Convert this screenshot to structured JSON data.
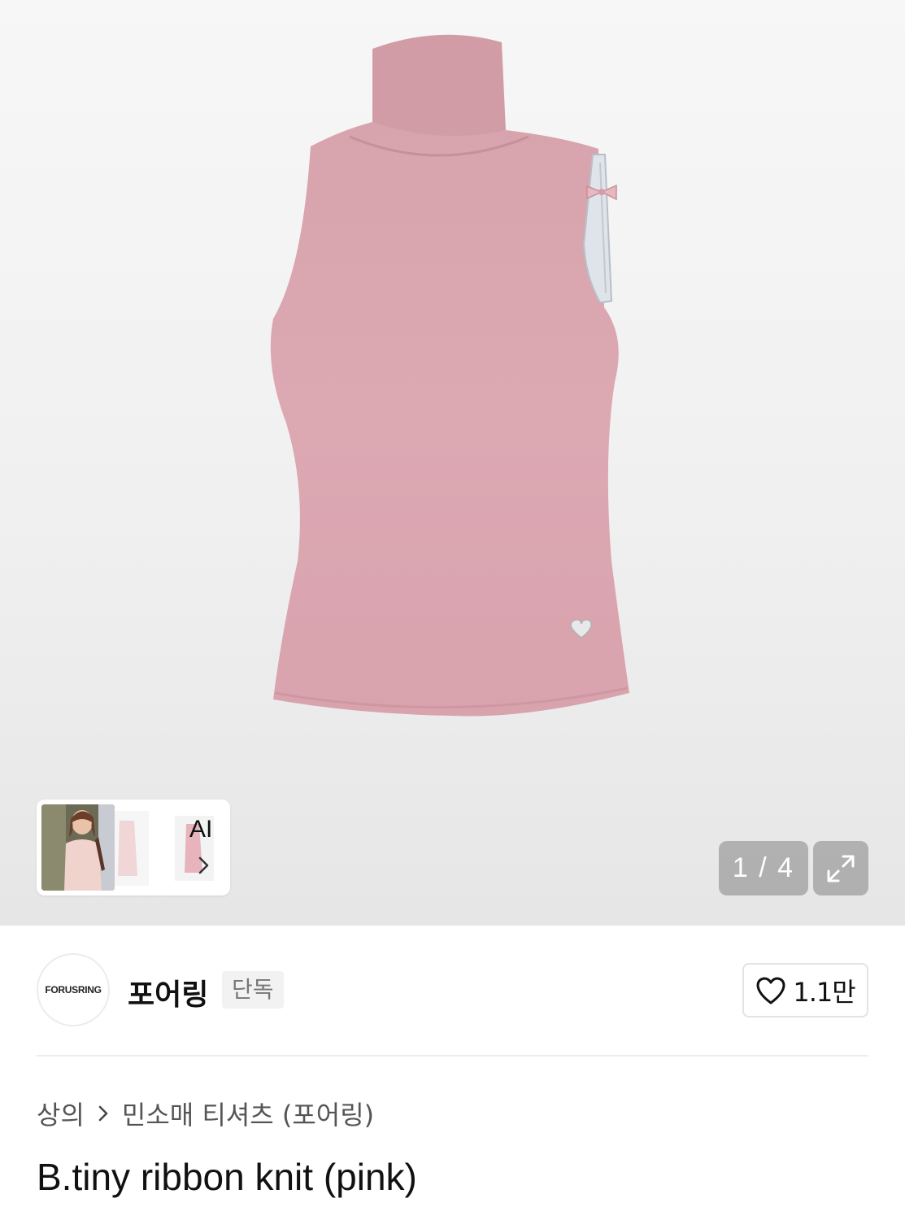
{
  "gallery": {
    "counter": "1 / 4",
    "ai_label": "AI"
  },
  "brand": {
    "logo_text": "FORUSRING",
    "name": "포어링",
    "badge": "단독"
  },
  "like": {
    "count": "1.1만"
  },
  "breadcrumb": {
    "category": "상의",
    "subcategory": "민소매 티셔츠 (포어링)"
  },
  "product": {
    "title": "B.tiny ribbon knit (pink)"
  },
  "colors": {
    "knit_pink": "#dca8b2",
    "overlay_gray": "#8c8c8c"
  }
}
